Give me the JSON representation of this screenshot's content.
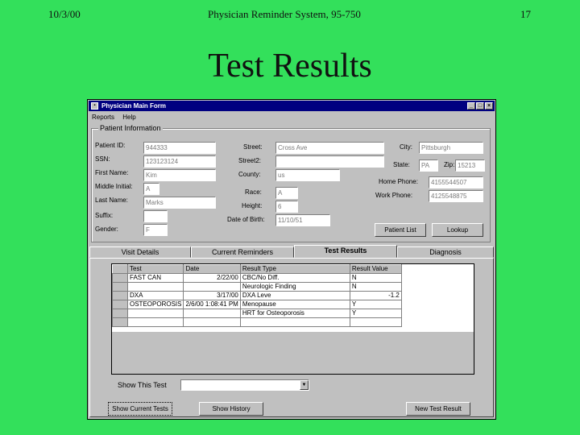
{
  "slide": {
    "date": "10/3/00",
    "header": "Physician Reminder System, 95-750",
    "page": "17",
    "title": "Test Results"
  },
  "window": {
    "title": "Physician Main Form",
    "menu": [
      "Reports",
      "Help"
    ],
    "controls": [
      "_",
      "□",
      "×"
    ]
  },
  "patient": {
    "group_label": "Patient Information",
    "labels": {
      "id": "Patient ID:",
      "ssn": "SSN:",
      "first": "First Name:",
      "mi": "Middle Initial:",
      "last": "Last Name:",
      "suffix": "Suffix:",
      "gender": "Gender:",
      "street": "Street:",
      "street2": "Street2:",
      "county": "County:",
      "race": "Race:",
      "height": "Height:",
      "dob": "Date of Birth:",
      "city": "City:",
      "state": "State:",
      "zip": "Zip:",
      "home": "Home Phone:",
      "work": "Work Phone:"
    },
    "values": {
      "id": "944333",
      "ssn": "123123124",
      "first": "Kim",
      "mi": "A",
      "last": "Marks",
      "suffix": "",
      "gender": "F",
      "street": "Cross Ave",
      "street2": "",
      "county": "us",
      "race": "A",
      "height": "6",
      "dob": "11/10/51",
      "city": "Pittsburgh",
      "state": "PA",
      "zip": "15213",
      "home": "4155544507",
      "work": "4125548875"
    },
    "buttons": {
      "list": "Patient List",
      "lookup": "Lookup"
    }
  },
  "tabs": [
    "Visit Details",
    "Current Reminders",
    "Test Results",
    "Diagnosis"
  ],
  "results": {
    "columns": [
      "Test",
      "Date",
      "Result Type",
      "Result Value"
    ],
    "rows": [
      [
        "FAST CAN",
        "2/22/00",
        "CBC/No Diff.",
        "N"
      ],
      [
        "",
        "",
        "Neurologic Finding",
        "N"
      ],
      [
        "DXA",
        "3/17/00",
        "DXA Leve",
        "-1.2"
      ],
      [
        "OSTEOPOROSIS",
        "2/6/00 1:08:41 PM",
        "Menopause",
        "Y"
      ],
      [
        "",
        "",
        "HRT for Osteoporosis",
        "Y"
      ],
      [
        "",
        "",
        "",
        ""
      ]
    ]
  },
  "filter": {
    "label": "Show This Test",
    "value": ""
  },
  "footer_buttons": [
    "Show Current Tests",
    "Show History",
    "New Test Result"
  ],
  "colors": {
    "slide_bg": "#33e05b",
    "titlebar": "#000080",
    "face": "#c0c0c0"
  }
}
